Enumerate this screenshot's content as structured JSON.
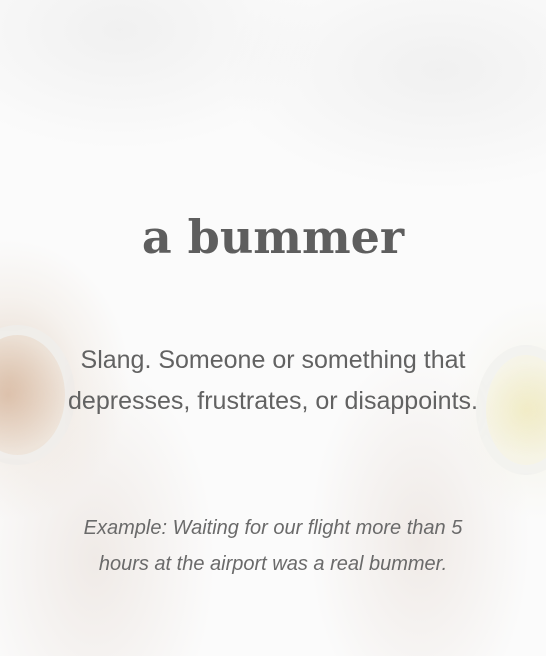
{
  "term": "a bummer",
  "definition": {
    "line1": "Slang. Someone or something that",
    "line2": "depresses, frustrates, or disappoints."
  },
  "example": {
    "line1": "Example: Waiting for our flight more than 5",
    "line2": "hours at the airport was a real bummer."
  },
  "colors": {
    "title_text": "#5e5e5e",
    "body_text": "#626262",
    "background": "#fbfbfb"
  }
}
